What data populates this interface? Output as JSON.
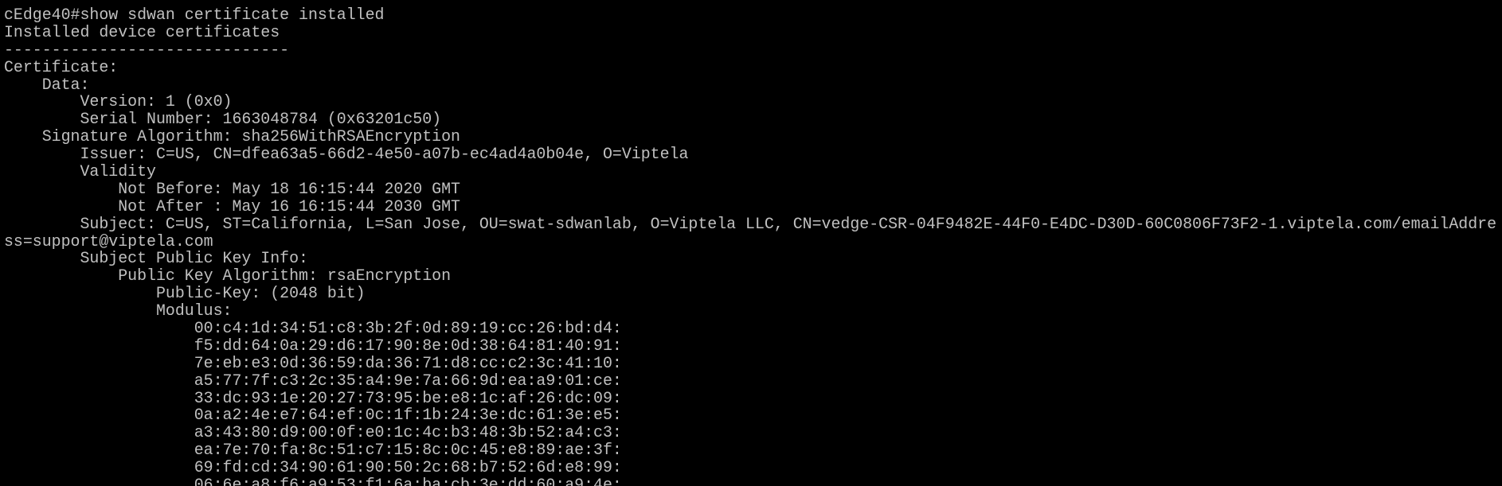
{
  "terminal": {
    "lines": [
      "cEdge40#show sdwan certificate installed",
      "Installed device certificates",
      "------------------------------",
      "Certificate:",
      "    Data:",
      "        Version: 1 (0x0)",
      "        Serial Number: 1663048784 (0x63201c50)",
      "    Signature Algorithm: sha256WithRSAEncryption",
      "        Issuer: C=US, CN=dfea63a5-66d2-4e50-a07b-ec4ad4a0b04e, O=Viptela",
      "        Validity",
      "            Not Before: May 18 16:15:44 2020 GMT",
      "            Not After : May 16 16:15:44 2030 GMT",
      "        Subject: C=US, ST=California, L=San Jose, OU=swat-sdwanlab, O=Viptela LLC, CN=vedge-CSR-04F9482E-44F0-E4DC-D30D-60C0806F73F2-1.viptela.com/emailAddre",
      "ss=support@viptela.com",
      "        Subject Public Key Info:",
      "            Public Key Algorithm: rsaEncryption",
      "                Public-Key: (2048 bit)",
      "                Modulus:",
      "                    00:c4:1d:34:51:c8:3b:2f:0d:89:19:cc:26:bd:d4:",
      "                    f5:dd:64:0a:29:d6:17:90:8e:0d:38:64:81:40:91:",
      "                    7e:eb:e3:0d:36:59:da:36:71:d8:cc:c2:3c:41:10:",
      "                    a5:77:7f:c3:2c:35:a4:9e:7a:66:9d:ea:a9:01:ce:",
      "                    33:dc:93:1e:20:27:73:95:be:e8:1c:af:26:dc:09:",
      "                    0a:a2:4e:e7:64:ef:0c:1f:1b:24:3e:dc:61:3e:e5:",
      "                    a3:43:80:d9:00:0f:e0:1c:4c:b3:48:3b:52:a4:c3:",
      "                    ea:7e:70:fa:8c:51:c7:15:8c:0c:45:e8:89:ae:3f:",
      "                    69:fd:cd:34:90:61:90:50:2c:68:b7:52:6d:e8:99:",
      "                    06:6e:a8:f6:a9:53:f1:6a:ba:cb:3e:dd:60:a9:4e:"
    ],
    "colors": {
      "background": "#000000",
      "foreground": "#c0c0c0"
    }
  }
}
